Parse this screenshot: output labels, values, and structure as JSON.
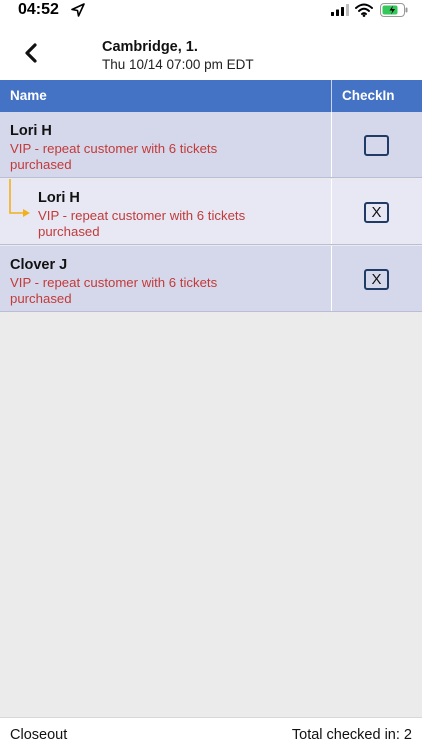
{
  "status_bar": {
    "time": "04:52",
    "icons": [
      "location-arrow-icon",
      "signal-icon",
      "wifi-icon",
      "battery-icon"
    ]
  },
  "header": {
    "title": "Cambridge, 1.",
    "subtitle": "Thu 10/14 07:00 pm EDT",
    "back_icon": "chevron-left-icon"
  },
  "table": {
    "columns": [
      "Name",
      "CheckIn"
    ],
    "rows": [
      {
        "name": "Lori H",
        "note": "VIP - repeat customer with 6 tickets purchased",
        "checked": false,
        "mark": "",
        "child": false
      },
      {
        "name": "Lori H",
        "note": "VIP - repeat customer with 6 tickets purchased",
        "checked": true,
        "mark": "X",
        "child": true
      },
      {
        "name": "Clover J",
        "note": "VIP - repeat customer with 6 tickets purchased",
        "checked": true,
        "mark": "X",
        "child": false
      }
    ]
  },
  "footer": {
    "closeout_label": "Closeout",
    "total_label": "Total checked in: 2"
  },
  "colors": {
    "header_bar": "#4472c4",
    "row_dark": "#d5d8ea",
    "row_light": "#e7e8f3",
    "note_text": "#c23a3a",
    "child_arrow": "#f2b01e",
    "background": "#ebebeb"
  }
}
